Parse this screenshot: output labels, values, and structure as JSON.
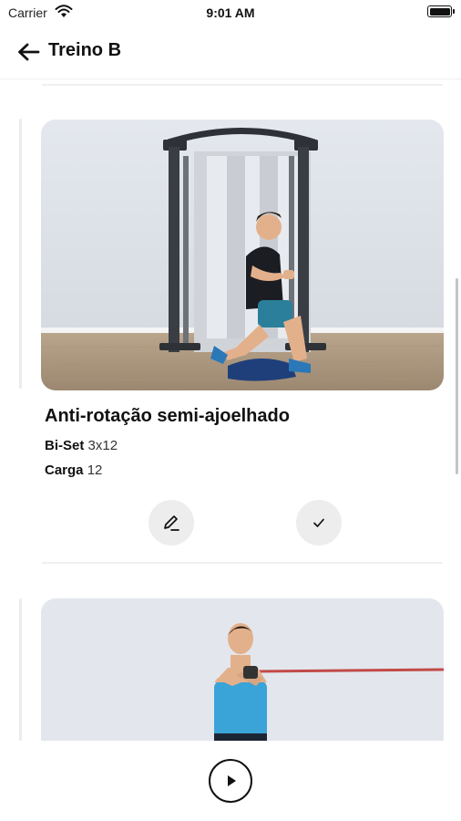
{
  "status_bar": {
    "carrier": "Carrier",
    "time": "9:01 AM",
    "icons": [
      "wifi-icon",
      "battery-icon"
    ]
  },
  "header": {
    "title": "Treino B",
    "back_icon": "arrow-left-icon"
  },
  "exercises": [
    {
      "title": "Anti-rotação semi-ajoelhado",
      "type_label": "Bi-Set",
      "type_value": "3x12",
      "load_label": "Carga",
      "load_value": "12",
      "actions": [
        "pencil-icon",
        "check-icon"
      ]
    },
    {
      "title": "",
      "image": "man-cable-press-photo"
    }
  ],
  "footer": {
    "play_icon": "play-icon"
  },
  "colors": {
    "background": "#ffffff",
    "text": "#111111",
    "button_bg": "#ededed",
    "divider": "#f0f0f0"
  }
}
